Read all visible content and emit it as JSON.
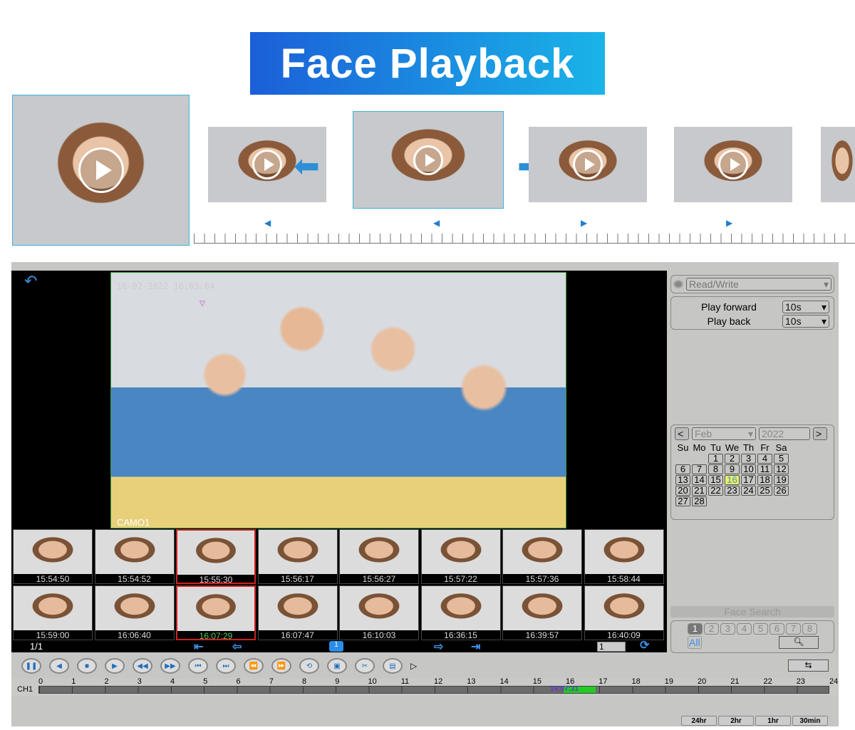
{
  "banner": {
    "title": "Face Playback"
  },
  "dvr": {
    "back_icon": "back-arrow-icon",
    "video": {
      "timestamp": "16-02-2022 16:03:04",
      "camera": "CAMO1"
    },
    "thumbnails": [
      [
        "15:54:50",
        "15:54:52",
        "15:55:30",
        "15:56:17",
        "15:56:27",
        "15:57:22",
        "15:57:36",
        "15:58:44"
      ],
      [
        "15:59:00",
        "16:06:40",
        "16:07:29",
        "16:07:47",
        "16:10:03",
        "16:36:15",
        "16:39:57",
        "16:40:09"
      ]
    ],
    "page_indicator": "1/1",
    "current_page": "1",
    "page_input": "1",
    "side": {
      "mode": "Read/Write",
      "play_forward_label": "Play forward",
      "play_forward_value": "10s",
      "play_back_label": "Play back",
      "play_back_value": "10s",
      "calendar": {
        "month": "Feb",
        "year": "2022",
        "prev": "<",
        "next": ">",
        "weekdays": [
          "Su",
          "Mo",
          "Tu",
          "We",
          "Th",
          "Fr",
          "Sa"
        ],
        "weeks": [
          [
            "",
            "",
            "1",
            "2",
            "3",
            "4",
            "5"
          ],
          [
            "6",
            "7",
            "8",
            "9",
            "10",
            "11",
            "12"
          ],
          [
            "13",
            "14",
            "15",
            "16",
            "17",
            "18",
            "19"
          ],
          [
            "20",
            "21",
            "22",
            "23",
            "24",
            "25",
            "26"
          ],
          [
            "27",
            "28",
            "",
            "",
            "",
            "",
            ""
          ]
        ],
        "selected": "16"
      },
      "face_search": "Face Search",
      "channels": [
        "1",
        "2",
        "3",
        "4",
        "5",
        "6",
        "7",
        "8"
      ],
      "all_label": "All"
    },
    "timeline": {
      "channel": "CH1",
      "hours": [
        "0",
        "1",
        "2",
        "3",
        "4",
        "5",
        "6",
        "7",
        "8",
        "9",
        "10",
        "11",
        "12",
        "13",
        "14",
        "15",
        "16",
        "17",
        "18",
        "19",
        "20",
        "21",
        "22",
        "23",
        "24"
      ],
      "marker": "16:07:31",
      "zoom": [
        "24hr",
        "2hr",
        "1hr",
        "30min"
      ]
    },
    "colors": {
      "accent": "#2d8fd6",
      "selected_border": "#cc2222",
      "record": "#22cc33"
    }
  }
}
